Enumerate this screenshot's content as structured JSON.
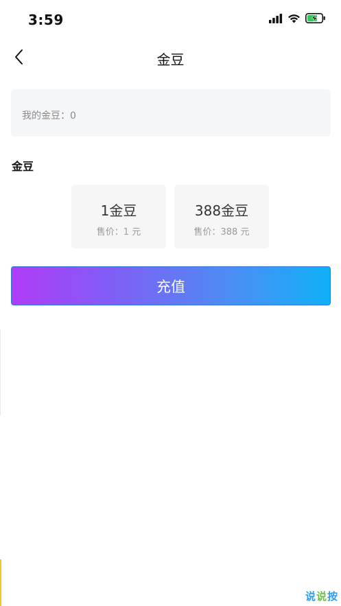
{
  "status_bar": {
    "time": "3:59"
  },
  "nav": {
    "title": "金豆"
  },
  "balance": {
    "text": "我的金豆：0"
  },
  "section": {
    "title": "金豆"
  },
  "packages": [
    {
      "amount": "1金豆",
      "price": "售价：1 元"
    },
    {
      "amount": "388金豆",
      "price": "售价：388 元"
    }
  ],
  "actions": {
    "recharge_label": "充值"
  },
  "watermark": {
    "chars": [
      "说",
      "说",
      "按"
    ]
  },
  "colors": {
    "gradient_start": "#b03cf7",
    "gradient_end": "#10b0f7",
    "card_background": "#f6f6f6",
    "battery_green": "#35c759"
  },
  "icons": {
    "back": "chevron-left-icon",
    "signal": "cellular-signal-icon",
    "wifi": "wifi-icon",
    "battery": "battery-charging-icon"
  }
}
